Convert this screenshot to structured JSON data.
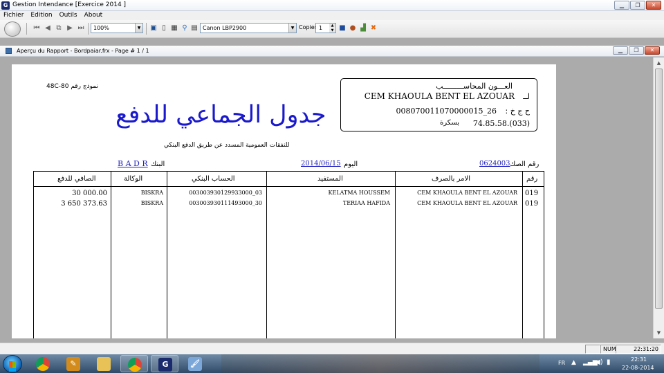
{
  "window": {
    "app_icon": "G",
    "title": "Gestion Intendance [Exercice  2014 ]",
    "buttons": [
      "minimize-icon",
      "restore-icon",
      "close-icon"
    ]
  },
  "menu": [
    "Fichier",
    "Edition",
    "Outils",
    "About"
  ],
  "toolbar": {
    "zoom": "100%",
    "printer": "Canon LBP2900",
    "copies_label": "Copies",
    "copies_value": "1"
  },
  "preview": {
    "title": "Aperçu du Rapport - Bordpaiar.frx - Page # 1 / 1"
  },
  "report": {
    "model": "نموذج رقم 80-48C",
    "accountant_title": "العـــون المحاســـــــــب",
    "accountant_prefix": "لــ",
    "accountant_name": "CEM KHAOULA BENT  EL AZOUAR",
    "account_prefix": "ح ج خ :",
    "account_no": "008070011070000015_26",
    "phone": "(033).74.85.58",
    "city": "بسكرة",
    "title": "جدول الجماعي للدفع",
    "subtitle": "للنفقات العمومية المسدد عن طريق الدفع البنكي",
    "cheque_label": "رقم الصك",
    "cheque_value": "0624003",
    "date_label": "اليوم",
    "date_value": "2014/06/15",
    "bank_label": "البنك",
    "bank_value": "B A D R",
    "columns": {
      "num": "رقم",
      "ordonnateur": "الامر بالصرف",
      "beneficiaire": "المستفيد",
      "compte": "الحساب البنكي",
      "agence": "الوكالة",
      "net": "الصافي للدفع"
    },
    "rows": [
      {
        "num": "019",
        "ordonnateur": "CEM KHAOULA BENT  EL AZOUAR",
        "beneficiaire": "KELATMA HOUSSEM",
        "compte": "003003930129933000_03",
        "agence": "BISKRA",
        "net": "30 000.00"
      },
      {
        "num": "019",
        "ordonnateur": "CEM KHAOULA BENT  EL AZOUAR",
        "beneficiaire": "TERIAA HAFIDA",
        "compte": "003003930111493000_30",
        "agence": "BISKRA",
        "net": "3 650 373.63"
      }
    ]
  },
  "status": {
    "num": "NUM",
    "time": "22:31:20"
  },
  "taskbar": {
    "lang": "FR",
    "clock_time": "22:31",
    "clock_date": "22-08-2014",
    "g_icon": "G"
  }
}
